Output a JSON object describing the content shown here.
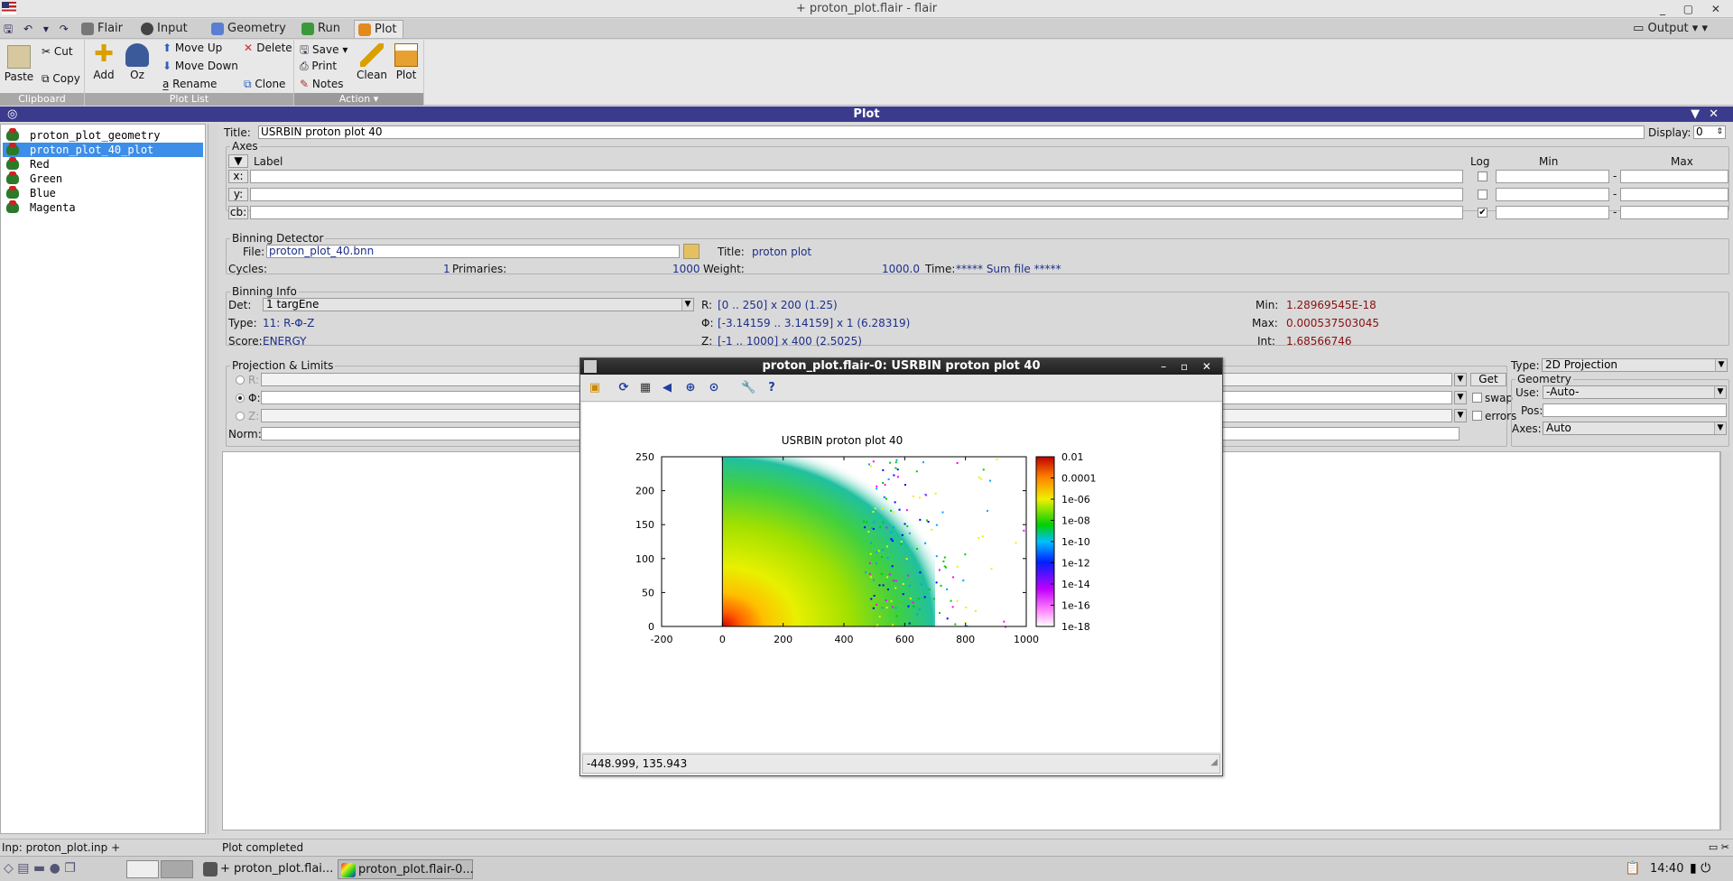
{
  "window": {
    "title": "+ proton_plot.flair - flair"
  },
  "tabs": [
    "Flair",
    "Input",
    "Geometry",
    "Run",
    "Plot"
  ],
  "active_tab": "Plot",
  "output_label": "Output",
  "ribbon": {
    "clipboard": {
      "paste": "Paste",
      "cut": "Cut",
      "copy": "Copy",
      "label": "Clipboard"
    },
    "plotlist": {
      "add": "Add",
      "oz": "Oz",
      "move_up": "Move Up",
      "move_down": "Move Down",
      "rename": "Rename",
      "delete": "Delete",
      "clone": "Clone",
      "label": "Plot List"
    },
    "action": {
      "save": "Save",
      "print": "Print",
      "notes": "Notes",
      "clean": "Clean",
      "plot": "Plot",
      "label": "Action"
    }
  },
  "panel_title": "Plot",
  "plot_list": [
    "proton_plot_geometry",
    "proton_plot_40_plot",
    "Red",
    "Green",
    "Blue",
    "Magenta"
  ],
  "selected_plot": "proton_plot_40_plot",
  "form": {
    "title_label": "Title:",
    "title_value": "USRBIN proton plot 40",
    "display_label": "Display:",
    "display_value": "0",
    "axes": {
      "frame": "Axes",
      "label_hdr": "Label",
      "log_hdr": "Log",
      "min_hdr": "Min",
      "max_hdr": "Max",
      "rows": [
        {
          "axis": "x:",
          "log": false
        },
        {
          "axis": "y:",
          "log": false
        },
        {
          "axis": "cb:",
          "log": true
        }
      ]
    },
    "binning_detector": {
      "frame": "Binning Detector",
      "file_label": "File:",
      "file_value": "proton_plot_40.bnn",
      "title_label": "Title:",
      "title_value": "proton plot",
      "cycles_label": "Cycles:",
      "cycles_value": "1",
      "primaries_label": "Primaries:",
      "primaries_value": "1000",
      "weight_label": "Weight:",
      "weight_value": "1000.0",
      "time_label": "Time:",
      "time_value": "***** Sum file *****"
    },
    "binning_info": {
      "frame": "Binning Info",
      "det_label": "Det:",
      "det_value": "1 targEne",
      "type_label": "Type:",
      "type_value": "11: R-Φ-Z",
      "score_label": "Score:",
      "score_value": "ENERGY",
      "r_label": "R:",
      "r_value": "[0 .. 250] x 200 (1.25)",
      "phi_label": "Φ:",
      "phi_value": "[-3.14159 .. 3.14159] x 1 (6.28319)",
      "z_label": "Z:",
      "z_value": "[-1 .. 1000] x 400 (2.5025)",
      "min_label": "Min:",
      "min_value": "1.28969545E-18",
      "max_label": "Max:",
      "max_value": "0.000537503045",
      "int_label": "Int:",
      "int_value": "1.68566746"
    },
    "projection": {
      "frame": "Projection & Limits",
      "r_label": "R:",
      "phi_label": "Φ:",
      "z_label": "Z:",
      "norm_label": "Norm:",
      "selected": "Φ:",
      "get_label": "Get",
      "swap_label": "swap",
      "errors_label": "errors",
      "type_label": "Type:",
      "type_value": "2D Projection",
      "geometry_frame": "Geometry",
      "use_label": "Use:",
      "use_value": "-Auto-",
      "pos_label": "Pos:",
      "axes_label": "Axes:",
      "axes_value": "Auto"
    }
  },
  "status": {
    "left": "Inp: proton_plot.inp +",
    "msg": "Plot completed"
  },
  "taskbar": {
    "item1": "+ proton_plot.flai...",
    "item2": "proton_plot.flair-0...",
    "clock": "14:40"
  },
  "popup": {
    "title": "proton_plot.flair-0: USRBIN proton plot 40",
    "status": "-448.999,  135.943"
  },
  "chart_data": {
    "type": "heatmap",
    "title": "USRBIN proton plot 40",
    "xlabel": "",
    "ylabel": "",
    "xlim": [
      -200,
      1000
    ],
    "ylim": [
      0,
      250
    ],
    "xticks": [
      "-200",
      "0",
      "200",
      "400",
      "600",
      "800",
      "1000"
    ],
    "yticks": [
      "0",
      "50",
      "100",
      "150",
      "200",
      "250"
    ],
    "colorbar": {
      "log": true,
      "ticks": [
        "0.01",
        "0.0001",
        "1e-06",
        "1e-08",
        "1e-10",
        "1e-12",
        "1e-14",
        "1e-16",
        "1e-18"
      ],
      "range": [
        1e-18,
        0.01
      ]
    },
    "colors": {
      "high": "#d40000",
      "mid": "#f0f000",
      "low_mid": "#00c800",
      "low": "#0000ff",
      "lowest": "#ff00ff"
    }
  }
}
